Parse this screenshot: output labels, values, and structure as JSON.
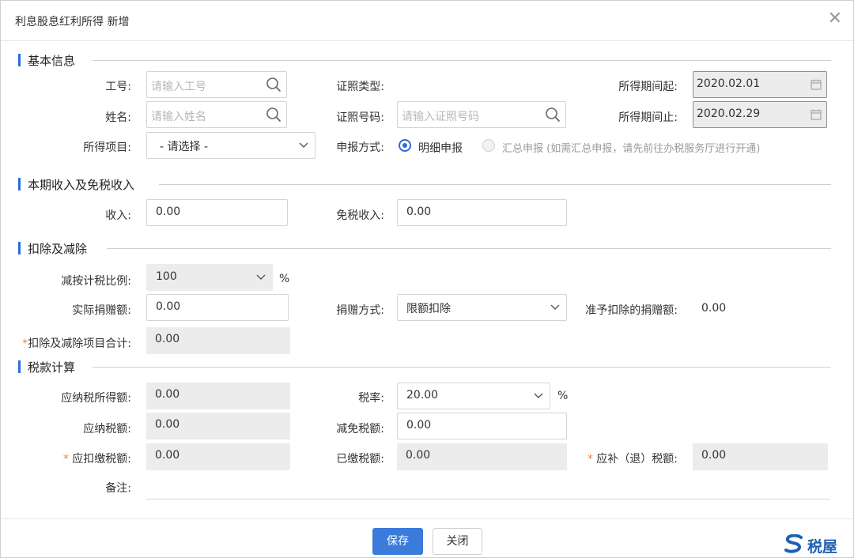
{
  "dialog": {
    "title": "利息股息红利所得 新增",
    "close": "✕"
  },
  "sections": {
    "basic": "基本信息",
    "income": "本期收入及免税收入",
    "deduction": "扣除及减除",
    "tax": "税款计算"
  },
  "basic": {
    "employee_id": {
      "label": "工号:",
      "placeholder": "请输入工号"
    },
    "name": {
      "label": "姓名:",
      "placeholder": "请输入姓名"
    },
    "income_item": {
      "label": "所得项目:",
      "value": "- 请选择 -"
    },
    "id_type": {
      "label": "证照类型:"
    },
    "id_number": {
      "label": "证照号码:",
      "placeholder": "请输入证照号码"
    },
    "declare_method": {
      "label": "申报方式:",
      "option_detail": "明细申报",
      "option_summary": "汇总申报 (如需汇总申报，请先前往办税服务厅进行开通)",
      "selected": "明细申报"
    },
    "period_start": {
      "label": "所得期间起:",
      "value": "2020.02.01"
    },
    "period_end": {
      "label": "所得期间止:",
      "value": "2020.02.29"
    }
  },
  "income": {
    "income": {
      "label": "收入:",
      "value": "0.00"
    },
    "tax_free": {
      "label": "免税收入:",
      "value": "0.00"
    }
  },
  "deduction": {
    "ratio": {
      "label": "减按计税比例:",
      "value": "100",
      "unit": "%"
    },
    "actual_donation": {
      "label": "实际捐赠额:",
      "value": "0.00"
    },
    "donation_method": {
      "label": "捐赠方式:",
      "value": "限额扣除"
    },
    "allowed_donation": {
      "label": "准予扣除的捐赠额:",
      "value": "0.00"
    },
    "total": {
      "required": "*",
      "label": "扣除及减除项目合计:",
      "value": "0.00"
    }
  },
  "tax": {
    "taxable_income": {
      "label": "应纳税所得额:",
      "value": "0.00"
    },
    "rate": {
      "label": "税率:",
      "value": "20.00",
      "unit": "%"
    },
    "tax_payable": {
      "label": "应纳税额:",
      "value": "0.00"
    },
    "tax_reduction": {
      "label": "减免税额:",
      "value": "0.00"
    },
    "tax_withheld": {
      "required": "*",
      "label": "应扣缴税额:",
      "value": "0.00"
    },
    "tax_paid": {
      "label": "已缴税额:",
      "value": "0.00"
    },
    "tax_due": {
      "required": "*",
      "label": "应补（退）税额:",
      "value": "0.00"
    },
    "remark": {
      "label": "备注:"
    }
  },
  "footer": {
    "save": "保存",
    "close": "关闭"
  },
  "watermark": {
    "text": "税屋"
  },
  "colors": {
    "accent": "#3a7bdc",
    "required": "#f0843c",
    "readonly_bg": "#ececec"
  }
}
